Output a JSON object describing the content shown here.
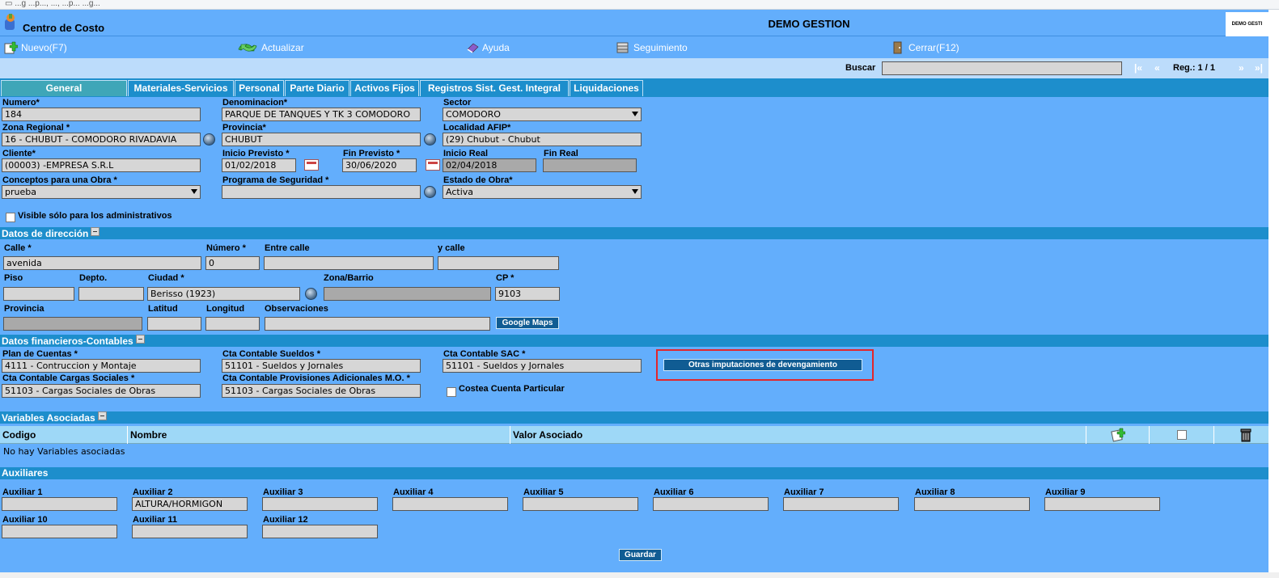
{
  "browser": {
    "strip_text": "▭ ...g      ...p...,  ...,  ...p...  ...g..."
  },
  "header": {
    "title": "Centro de Costo",
    "company": "DEMO GESTION",
    "logo_text": "DEMO GESTI"
  },
  "toolbar": {
    "nuevo": "Nuevo(F7)",
    "actualizar": "Actualizar",
    "ayuda": "Ayuda",
    "seguimiento": "Seguimiento",
    "cerrar": "Cerrar(F12)"
  },
  "search": {
    "label": "Buscar",
    "value": "",
    "first": "|«",
    "prev": "«",
    "reg_label": "Reg.: 1 / 1",
    "next": "»",
    "last": "»|"
  },
  "tabs": [
    "General",
    "Materiales-Servicios",
    "Personal",
    "Parte Diario",
    "Activos Fijos",
    "Registros Sist. Gest. Integral",
    "Liquidaciones"
  ],
  "general": {
    "numero": {
      "label": "Numero*",
      "value": "184"
    },
    "denominacion": {
      "label": "Denominacion*",
      "value": "PARQUE DE TANQUES Y TK 3 COMODORO"
    },
    "sector": {
      "label": "Sector",
      "value": "COMODORO"
    },
    "zona_regional": {
      "label": "Zona Regional *",
      "value": "16 - CHUBUT - COMODORO RIVADAVIA"
    },
    "provincia": {
      "label": "Provincia*",
      "value": "CHUBUT"
    },
    "localidad_afip": {
      "label": "Localidad AFIP*",
      "value": "(29) Chubut - Chubut"
    },
    "cliente": {
      "label": "Cliente*",
      "value": "(00003) -EMPRESA S.R.L"
    },
    "inicio_previsto": {
      "label": "Inicio Previsto *",
      "value": "01/02/2018"
    },
    "fin_previsto": {
      "label": "Fin Previsto *",
      "value": "30/06/2020"
    },
    "inicio_real": {
      "label": "Inicio Real",
      "value": "02/04/2018"
    },
    "fin_real": {
      "label": "Fin Real",
      "value": ""
    },
    "conceptos": {
      "label": "Conceptos para una Obra *",
      "value": "prueba"
    },
    "programa_seguridad": {
      "label": "Programa de Seguridad *",
      "value": ""
    },
    "estado_obra": {
      "label": "Estado de Obra*",
      "value": "Activa"
    },
    "visible_admin": {
      "label": "Visible sólo para los administrativos",
      "checked": false
    }
  },
  "direccion": {
    "section_title": "Datos de dirección",
    "calle": {
      "label": "Calle *",
      "value": "avenida"
    },
    "numero": {
      "label": "Número *",
      "value": "0"
    },
    "entre_calle": {
      "label": "Entre calle",
      "value": ""
    },
    "y_calle": {
      "label": "y calle",
      "value": ""
    },
    "piso": {
      "label": "Piso",
      "value": ""
    },
    "depto": {
      "label": "Depto.",
      "value": ""
    },
    "ciudad": {
      "label": "Ciudad *",
      "value": "Berisso (1923)"
    },
    "zona_barrio": {
      "label": "Zona/Barrio",
      "value": ""
    },
    "cp": {
      "label": "CP *",
      "value": "9103"
    },
    "provincia": {
      "label": "Provincia",
      "value": ""
    },
    "latitud": {
      "label": "Latitud",
      "value": ""
    },
    "longitud": {
      "label": "Longitud",
      "value": ""
    },
    "observaciones": {
      "label": "Observaciones",
      "value": ""
    },
    "google_maps": "Google Maps"
  },
  "financieros": {
    "section_title": "Datos financieros-Contables",
    "plan_cuentas": {
      "label": "Plan de Cuentas *",
      "value": "4111 - Contruccion y Montaje"
    },
    "cta_sueldos": {
      "label": "Cta Contable Sueldos *",
      "value": "51101 - Sueldos y Jornales"
    },
    "cta_sac": {
      "label": "Cta Contable SAC *",
      "value": "51101 - Sueldos y Jornales"
    },
    "otras_imputaciones": "Otras imputaciones de devengamiento",
    "cta_cargas": {
      "label": "Cta Contable Cargas Sociales *",
      "value": "51103 - Cargas Sociales de Obras"
    },
    "cta_provisiones": {
      "label": "Cta Contable Provisiones Adicionales M.O. *",
      "value": "51103 - Cargas Sociales de Obras"
    },
    "costea_cuenta": {
      "label": "Costea Cuenta Particular",
      "checked": false
    }
  },
  "variables": {
    "section_title": "Variables Asociadas",
    "columns": [
      "Codigo",
      "Nombre",
      "Valor Asociado"
    ],
    "empty_text": "No hay Variables asociadas"
  },
  "auxiliares": {
    "section_title": "Auxiliares",
    "items": [
      {
        "label": "Auxiliar 1",
        "value": ""
      },
      {
        "label": "Auxiliar 2",
        "value": "ALTURA/HORMIGON"
      },
      {
        "label": "Auxiliar 3",
        "value": ""
      },
      {
        "label": "Auxiliar 4",
        "value": ""
      },
      {
        "label": "Auxiliar 5",
        "value": ""
      },
      {
        "label": "Auxiliar 6",
        "value": ""
      },
      {
        "label": "Auxiliar 7",
        "value": ""
      },
      {
        "label": "Auxiliar 8",
        "value": ""
      },
      {
        "label": "Auxiliar 9",
        "value": ""
      },
      {
        "label": "Auxiliar 10",
        "value": ""
      },
      {
        "label": "Auxiliar 11",
        "value": ""
      },
      {
        "label": "Auxiliar 12",
        "value": ""
      }
    ]
  },
  "guardar": "Guardar"
}
